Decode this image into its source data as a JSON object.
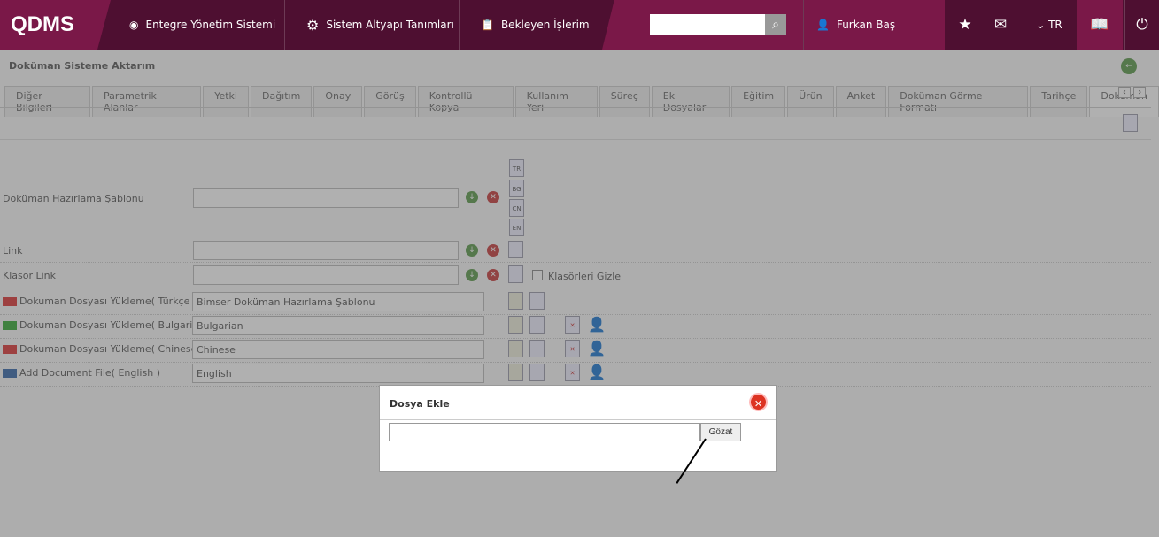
{
  "header": {
    "logo": "QDMS",
    "nav": [
      "Entegre Yönetim Sistemi",
      "Sistem Altyapı Tanımları",
      "Bekleyen İşlerim"
    ],
    "search_placeholder": "",
    "user": "Furkan Baş",
    "lang": "TR"
  },
  "page": {
    "title": "Doküman Sisteme Aktarım",
    "tabs": [
      "Diğer Bilgileri",
      "Parametrik Alanlar",
      "Yetki",
      "Dağıtım",
      "Onay",
      "Görüş",
      "Kontrollü Kopya",
      "Kullanım Yeri",
      "Süreç",
      "Ek Dosyalar",
      "Eğitim",
      "Ürün",
      "Anket",
      "Doküman Görme Formatı",
      "Tarihçe",
      "Doküman"
    ],
    "fields": {
      "template": "Doküman Hazırlama Şablonu",
      "link": "Link",
      "folder_link": "Klasor Link",
      "hide_folders": "Klasörleri Gizle"
    },
    "lang_docs": [
      "TR",
      "BG",
      "CN",
      "EN"
    ],
    "uploads": [
      {
        "label": "Dokuman Dosyası Yükleme( Türkçe )",
        "value": "Bimser Doküman Hazırlama Şablonu",
        "flag": "#d33"
      },
      {
        "label": "Dokuman Dosyası Yükleme( Bulgarian )",
        "value": "Bulgarian",
        "flag": "#3a3"
      },
      {
        "label": "Dokuman Dosyası Yükleme( Chinese )",
        "value": "Chinese",
        "flag": "#d33"
      },
      {
        "label": "Add Document File( English )",
        "value": "English",
        "flag": "#36a"
      }
    ]
  },
  "dialog": {
    "title": "Dosya Ekle",
    "browse": "Gözat"
  }
}
